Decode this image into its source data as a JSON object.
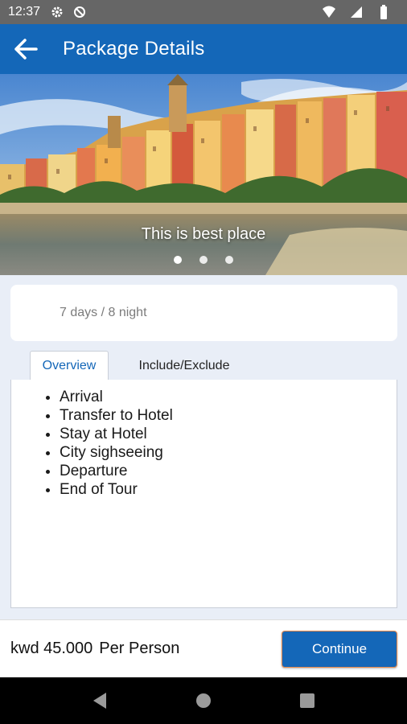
{
  "status_bar": {
    "time": "12:37"
  },
  "app_bar": {
    "title": "Package Details"
  },
  "hero": {
    "caption": "This is best place",
    "dots": 3,
    "active_dot": 0
  },
  "duration": "7 days / 8 night",
  "tabs": [
    {
      "label": "Overview",
      "active": true
    },
    {
      "label": "Include/Exclude",
      "active": false
    }
  ],
  "itinerary": [
    "Arrival",
    "Transfer to Hotel",
    "Stay at Hotel",
    "City sighseeing",
    "Departure",
    "End of Tour"
  ],
  "footer": {
    "price": "kwd 45.000",
    "per_label": "Per Person",
    "continue_label": "Continue"
  },
  "colors": {
    "primary": "#1467b8",
    "background": "#e9eef7",
    "status_bar": "#666666"
  }
}
